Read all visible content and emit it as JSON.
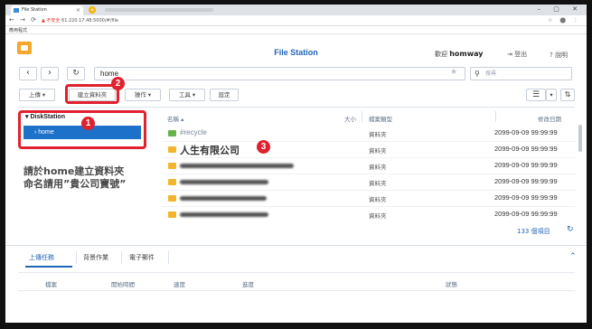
{
  "browser": {
    "tab_title": "File Station",
    "close_glyph": "×",
    "new_tab_glyph": "+",
    "window_controls": "– ▢ ✕",
    "nav_glyphs": "← → ⟳",
    "insecure_label": "▲ 不安全",
    "url": "61.220.17.48:5000/#/file",
    "extensions": "☆ ⬤ ⋮",
    "bookmark": "應用程式"
  },
  "app": {
    "title": "File Station",
    "welcome_prefix": "歡迎",
    "username": "homway",
    "logout": "⇥ 登出",
    "help": "? 說明",
    "back_glyph": "‹",
    "forward_glyph": "›",
    "refresh_glyph": "↻",
    "path": "home",
    "search_placeholder": "搜尋",
    "search_glyph": "⚲",
    "star_glyph": "★"
  },
  "toolbar": {
    "upload": "上傳 ▾",
    "create_folder": "建立資料夾",
    "action": "操作 ▾",
    "tools": "工具 ▾",
    "settings": "設定",
    "list_view": "☰",
    "view_dropdown": "▾",
    "sort": "⇅"
  },
  "sidebar": {
    "root": "▾ DiskStation",
    "home": "› home"
  },
  "annotations": {
    "badge1": "1",
    "badge2": "2",
    "badge3": "3",
    "note_line1": "請於home建立資料夾",
    "note_line2": "命名請用”貴公司寶號”",
    "color": "#e0212e"
  },
  "file_list": {
    "columns": {
      "name": "名稱 ▴",
      "size": "大小",
      "type": "檔案類型",
      "modified": "修改日期"
    },
    "rows": [
      {
        "name": "#recycle",
        "type": "資料夾",
        "date": "2099-09-09 99:99:99"
      },
      {
        "name": "人生有限公司",
        "type": "資料夾",
        "date": "2099-09-09 99:99:99"
      },
      {
        "name": "",
        "type": "資料夾",
        "date": "2099-09-09 99:99:99"
      },
      {
        "name": "",
        "type": "資料夾",
        "date": "2099-09-09 99:99:99"
      },
      {
        "name": "",
        "type": "資料夾",
        "date": "2099-09-09 99:99:99"
      },
      {
        "name": "",
        "type": "資料夾",
        "date": "2099-09-09 99:99:99"
      }
    ],
    "count": "133 個項目",
    "refresh_glyph": "↻"
  },
  "bottom": {
    "tabs": [
      "上傳任務",
      "背景作業",
      "電子郵件"
    ],
    "collapse_glyph": "⌃",
    "columns": [
      "檔案",
      "開始時間",
      "速度",
      "進度",
      "狀態"
    ]
  }
}
